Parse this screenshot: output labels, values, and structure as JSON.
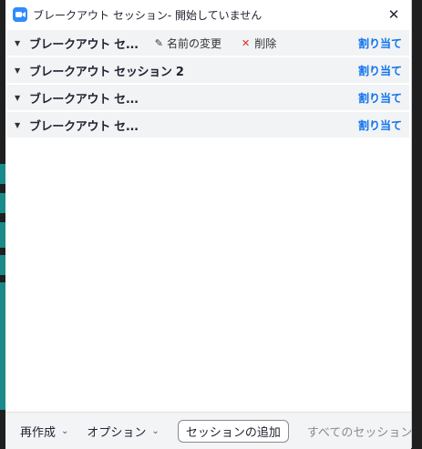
{
  "window": {
    "title": "ブレークアウト セッション- 開始していません"
  },
  "rooms": [
    {
      "name": "ブレークアウト セ...",
      "rename_label": "名前の変更",
      "delete_label": "削除",
      "assign_label": "割り当て"
    },
    {
      "name": "ブレークアウト セッション 2",
      "assign_label": "割り当て"
    },
    {
      "name": "ブレークアウト セ...",
      "assign_label": "割り当て"
    },
    {
      "name": "ブレークアウト セ...",
      "assign_label": "割り当て"
    }
  ],
  "footer": {
    "recreate_label": "再作成",
    "options_label": "オプション",
    "add_session_label": "セッションの追加",
    "all_sessions_label": "すべてのセッション"
  },
  "colors": {
    "accent": "#0e71eb",
    "app_icon": "#2d8cff",
    "delete": "#e02828",
    "background_stripe": "#1a8a8a"
  }
}
